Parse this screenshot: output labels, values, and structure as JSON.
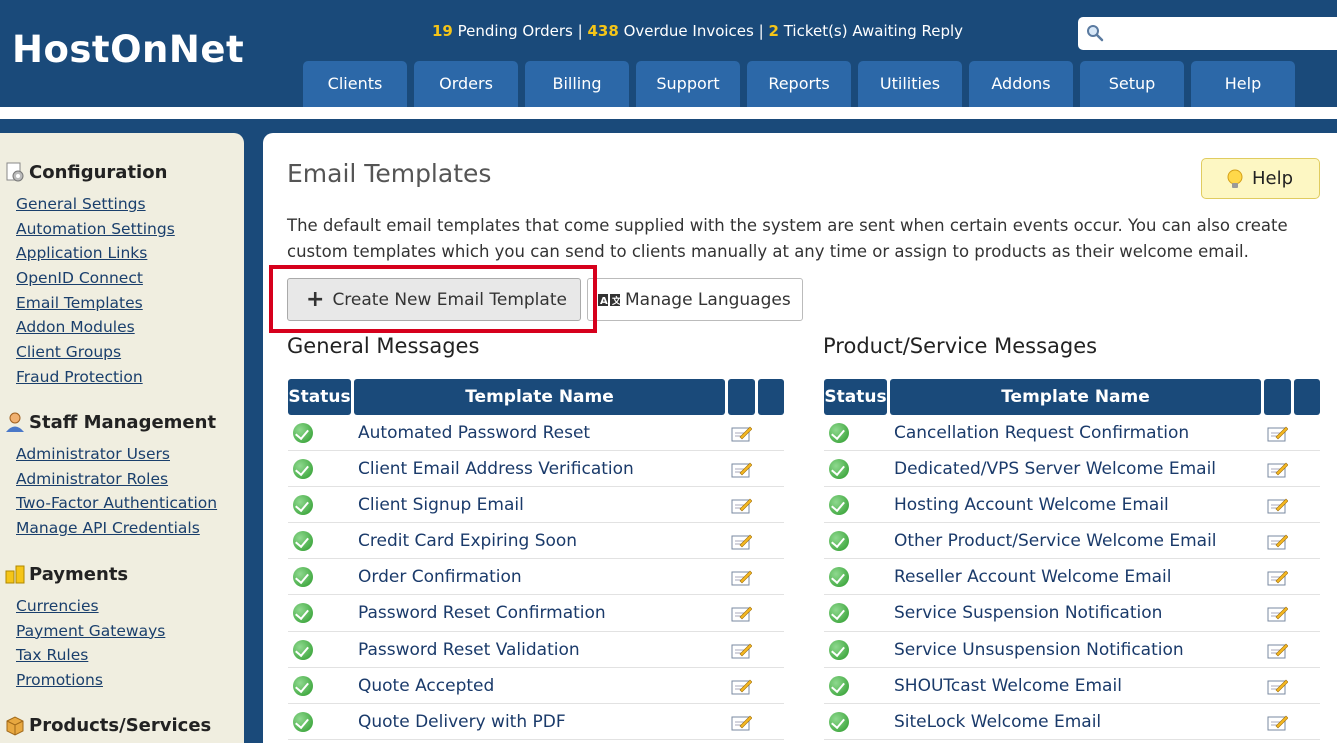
{
  "header": {
    "logo": "HostOnNet",
    "stats": {
      "pending_count": "19",
      "pending_label": "Pending Orders",
      "sep1": "|",
      "overdue_count": "438",
      "overdue_label": "Overdue Invoices",
      "sep2": "|",
      "tickets_count": "2",
      "tickets_label": "Ticket(s) Awaiting Reply"
    },
    "search": {
      "placeholder": "",
      "icon": "search-icon"
    },
    "nav": [
      "Clients",
      "Orders",
      "Billing",
      "Support",
      "Reports",
      "Utilities",
      "Addons",
      "Setup",
      "Help"
    ]
  },
  "sidebar": {
    "sections": [
      {
        "title": "Configuration",
        "icon": "gear-page-icon",
        "links": [
          "General Settings",
          "Automation Settings",
          "Application Links",
          "OpenID Connect",
          "Email Templates",
          "Addon Modules",
          "Client Groups",
          "Fraud Protection"
        ]
      },
      {
        "title": "Staff Management",
        "icon": "user-icon",
        "links": [
          "Administrator Users",
          "Administrator Roles",
          "Two-Factor Authentication",
          "Manage API Credentials"
        ]
      },
      {
        "title": "Payments",
        "icon": "coins-icon",
        "links": [
          "Currencies",
          "Payment Gateways",
          "Tax Rules",
          "Promotions"
        ]
      },
      {
        "title": "Products/Services",
        "icon": "box-icon",
        "links": []
      }
    ]
  },
  "main": {
    "title": "Email Templates",
    "help_label": "Help",
    "description": "The default email templates that come supplied with the system are sent when certain events occur. You can also create custom templates which you can send to clients manually at any time or assign to products as their welcome email.",
    "create_button": "Create New Email Template",
    "languages_button": "Manage Languages",
    "highlight_color": "#d6001c",
    "general": {
      "title": "General Messages",
      "headers": {
        "status": "Status",
        "name": "Template Name"
      },
      "rows": [
        "Automated Password Reset",
        "Client Email Address Verification",
        "Client Signup Email",
        "Credit Card Expiring Soon",
        "Order Confirmation",
        "Password Reset Confirmation",
        "Password Reset Validation",
        "Quote Accepted",
        "Quote Delivery with PDF"
      ]
    },
    "product": {
      "title": "Product/Service Messages",
      "headers": {
        "status": "Status",
        "name": "Template Name"
      },
      "rows": [
        "Cancellation Request Confirmation",
        "Dedicated/VPS Server Welcome Email",
        "Hosting Account Welcome Email",
        "Other Product/Service Welcome Email",
        "Reseller Account Welcome Email",
        "Service Suspension Notification",
        "Service Unsuspension Notification",
        "SHOUTcast Welcome Email",
        "SiteLock Welcome Email"
      ]
    }
  }
}
